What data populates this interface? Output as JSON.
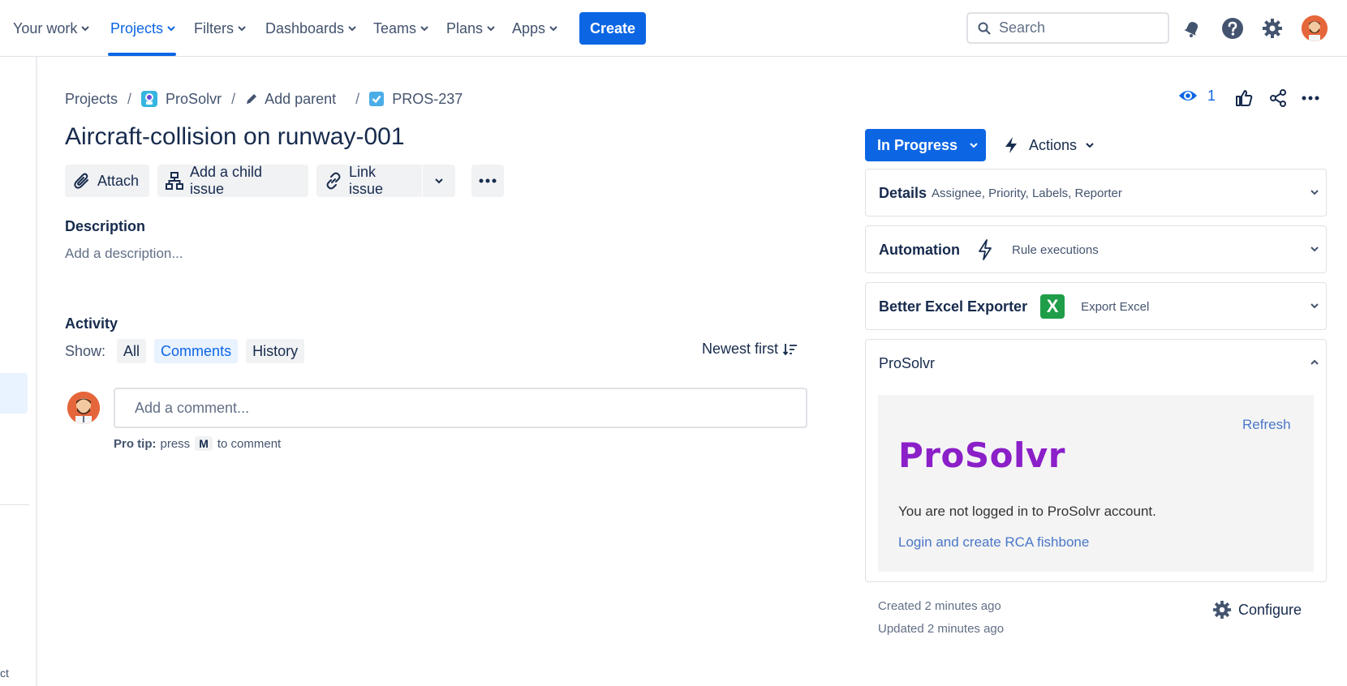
{
  "nav": {
    "items": [
      "Your work",
      "Projects",
      "Filters",
      "Dashboards",
      "Teams",
      "Plans",
      "Apps"
    ],
    "create_label": "Create",
    "search_placeholder": "Search",
    "accent": "#0c66e4"
  },
  "sidebar": {
    "partial_text": "ct"
  },
  "breadcrumb": {
    "projects": "Projects",
    "project": "ProSolvr",
    "add_parent": "Add parent",
    "issue_key": "PROS-237"
  },
  "issue": {
    "title": "Aircraft-collision on runway-001",
    "toolbar": {
      "attach": "Attach",
      "child": "Add a child issue",
      "link": "Link issue"
    }
  },
  "description": {
    "label": "Description",
    "placeholder": "Add a description..."
  },
  "activity": {
    "label": "Activity",
    "show_label": "Show:",
    "filters": [
      "All",
      "Comments",
      "History"
    ],
    "selected_filter": "Comments",
    "sort": "Newest first",
    "comment_placeholder": "Add a comment...",
    "protip_bold": "Pro tip:",
    "protip_press": "press",
    "protip_key": "M",
    "protip_rest": "to comment"
  },
  "header_actions": {
    "watch_count": "1"
  },
  "status": {
    "label": "In Progress",
    "actions_label": "Actions"
  },
  "panels": {
    "details": {
      "title": "Details",
      "sub": "Assignee, Priority, Labels, Reporter"
    },
    "automation": {
      "title": "Automation",
      "sub": "Rule executions"
    },
    "excel": {
      "title": "Better Excel Exporter",
      "sub": "Export Excel",
      "icon_letter": "X"
    },
    "prosolvr": {
      "title": "ProSolvr",
      "refresh": "Refresh",
      "brand": "ProSolvr",
      "message": "You are not logged in to ProSolvr account.",
      "login_link": "Login and create RCA fishbone"
    }
  },
  "meta": {
    "created": "Created 2 minutes ago",
    "updated": "Updated 2 minutes ago",
    "configure": "Configure"
  }
}
